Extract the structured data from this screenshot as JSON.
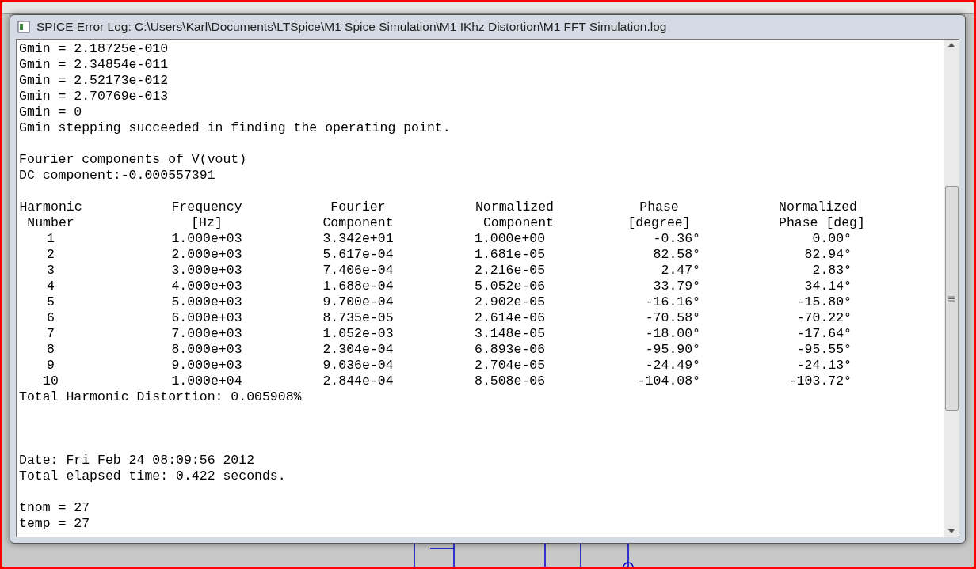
{
  "window": {
    "title": "SPICE Error Log: C:\\Users\\Karl\\Documents\\LTSpice\\M1 Spice Simulation\\M1 IKhz Distortion\\M1 FFT Simulation.log"
  },
  "log": {
    "before_table": [
      [
        "Gmin = 2.18725e-010",
        "Gmin = 2.34854e-011",
        "Gmin = 2.52173e-012",
        "Gmin = 2.70769e-013",
        "Gmin = 0",
        "Gmin stepping succeeded in finding the operating point."
      ],
      [
        "Fourier components of V(vout)",
        "DC component:-0.000557391"
      ]
    ],
    "table": {
      "header_rows": [
        [
          "Harmonic",
          "Frequency",
          "Fourier",
          "Normalized",
          "Phase",
          "Normalized"
        ],
        [
          "Number",
          "[Hz]",
          "Component",
          "Component",
          "[degree]",
          "Phase [deg]"
        ]
      ],
      "rows": [
        [
          "1",
          "1.000e+03",
          "3.342e+01",
          "1.000e+00",
          "-0.36°",
          "0.00°"
        ],
        [
          "2",
          "2.000e+03",
          "5.617e-04",
          "1.681e-05",
          "82.58°",
          "82.94°"
        ],
        [
          "3",
          "3.000e+03",
          "7.406e-04",
          "2.216e-05",
          "2.47°",
          "2.83°"
        ],
        [
          "4",
          "4.000e+03",
          "1.688e-04",
          "5.052e-06",
          "33.79°",
          "34.14°"
        ],
        [
          "5",
          "5.000e+03",
          "9.700e-04",
          "2.902e-05",
          "-16.16°",
          "-15.80°"
        ],
        [
          "6",
          "6.000e+03",
          "8.735e-05",
          "2.614e-06",
          "-70.58°",
          "-70.22°"
        ],
        [
          "7",
          "7.000e+03",
          "1.052e-03",
          "3.148e-05",
          "-18.00°",
          "-17.64°"
        ],
        [
          "8",
          "8.000e+03",
          "2.304e-04",
          "6.893e-06",
          "-95.90°",
          "-95.55°"
        ],
        [
          "9",
          "9.000e+03",
          "9.036e-04",
          "2.704e-05",
          "-24.49°",
          "-24.13°"
        ],
        [
          "10",
          "1.000e+04",
          "2.844e-04",
          "8.508e-06",
          "-104.08°",
          "-103.72°"
        ]
      ]
    },
    "after_table": [
      [
        "Total Harmonic Distortion: 0.005908%"
      ],
      [
        "Date: Fri Feb 24 08:09:56 2012",
        "Total elapsed time: 0.422 seconds."
      ],
      [
        "tnom = 27",
        "temp = 27"
      ]
    ]
  }
}
